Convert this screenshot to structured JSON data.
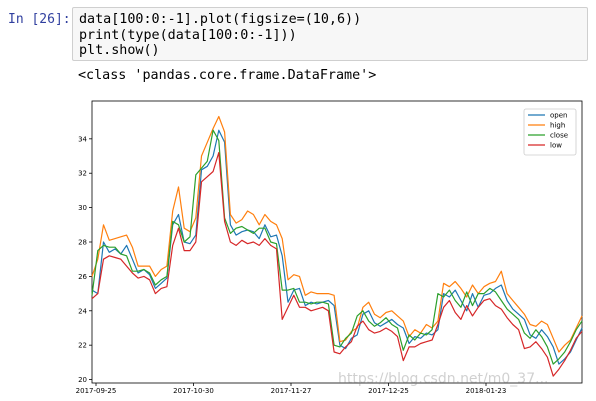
{
  "cell": {
    "prompt": "In [26]:",
    "code_lines": [
      "data[100:0:-1].plot(figsize=(10,6))",
      "print(type(data[100:0:-1]))",
      "plt.show()"
    ],
    "stdout": "<class 'pandas.core.frame.DataFrame'>"
  },
  "watermark": "https://blog.csdn.net/m0_37...",
  "chart_data": {
    "type": "line",
    "title": "",
    "xlabel": "",
    "ylabel": "",
    "ylim": [
      19.8,
      36.2
    ],
    "yticks": [
      20,
      22,
      24,
      26,
      28,
      30,
      32,
      34
    ],
    "xticks": [
      "2017-09-25",
      "2017-10-30",
      "2017-11-27",
      "2017-12-25",
      "2018-01-23"
    ],
    "legend_position": "top-right",
    "series": [
      {
        "name": "open",
        "color": "#1f77b4",
        "values": [
          25.2,
          25.0,
          28.0,
          27.4,
          27.6,
          27.3,
          27.8,
          27.0,
          26.2,
          26.4,
          26.1,
          25.3,
          25.6,
          25.9,
          29.0,
          29.6,
          28.0,
          27.9,
          28.4,
          32.2,
          32.4,
          33.0,
          34.5,
          33.8,
          29.0,
          28.4,
          28.6,
          28.7,
          28.6,
          28.2,
          29.0,
          28.3,
          28.4,
          27.2,
          24.5,
          25.2,
          25.3,
          24.3,
          24.5,
          24.4,
          24.5,
          24.6,
          24.3,
          22.0,
          21.8,
          22.4,
          22.6,
          23.8,
          24.0,
          23.3,
          23.1,
          23.3,
          23.5,
          23.2,
          23.0,
          22.1,
          22.5,
          22.4,
          22.7,
          22.6,
          22.9,
          25.0,
          24.8,
          25.2,
          24.6,
          24.0,
          25.0,
          24.2,
          24.9,
          25.0,
          25.3,
          25.5,
          24.6,
          24.1,
          23.8,
          23.5,
          22.6,
          22.4,
          22.9,
          22.5,
          21.9,
          20.9,
          21.2,
          21.6,
          22.3,
          23.0
        ]
      },
      {
        "name": "high",
        "color": "#ff7f0e",
        "values": [
          26.0,
          27.0,
          29.0,
          28.1,
          28.2,
          28.3,
          28.4,
          27.7,
          26.6,
          26.6,
          26.6,
          26.0,
          26.4,
          26.6,
          29.8,
          31.2,
          28.8,
          28.6,
          29.4,
          33.0,
          33.8,
          34.6,
          35.3,
          34.4,
          29.6,
          29.1,
          29.3,
          29.8,
          29.6,
          29.0,
          29.6,
          29.2,
          29.0,
          28.2,
          25.8,
          26.1,
          26.0,
          24.9,
          25.1,
          25.0,
          25.0,
          25.0,
          24.9,
          22.2,
          22.3,
          22.8,
          23.0,
          24.2,
          24.5,
          23.8,
          23.6,
          23.9,
          24.0,
          23.7,
          23.4,
          22.5,
          22.9,
          22.7,
          23.2,
          23.0,
          23.4,
          25.6,
          25.4,
          25.7,
          25.3,
          24.8,
          25.5,
          25.0,
          25.4,
          25.6,
          25.7,
          26.3,
          25.0,
          24.6,
          24.2,
          23.8,
          23.2,
          23.1,
          23.4,
          23.2,
          22.4,
          21.6,
          22.0,
          22.3,
          23.0,
          23.7
        ]
      },
      {
        "name": "close",
        "color": "#2ca02c",
        "values": [
          24.9,
          27.5,
          27.8,
          27.7,
          27.7,
          27.3,
          27.2,
          26.3,
          26.3,
          26.4,
          26.2,
          25.5,
          25.8,
          26.0,
          29.2,
          29.0,
          28.0,
          28.3,
          31.9,
          32.3,
          32.7,
          34.5,
          33.9,
          29.4,
          28.5,
          28.8,
          28.9,
          28.7,
          28.5,
          28.8,
          28.8,
          28.0,
          27.9,
          25.2,
          25.2,
          25.3,
          24.5,
          24.5,
          24.4,
          24.5,
          24.5,
          24.4,
          22.0,
          21.9,
          22.4,
          22.7,
          23.7,
          24.0,
          23.4,
          23.1,
          23.3,
          23.6,
          23.2,
          23.0,
          21.7,
          22.6,
          22.3,
          22.7,
          22.6,
          22.9,
          25.0,
          24.8,
          25.2,
          24.6,
          24.2,
          25.1,
          24.3,
          25.0,
          25.0,
          25.3,
          25.1,
          24.6,
          24.1,
          23.8,
          23.5,
          22.7,
          22.4,
          22.9,
          22.5,
          21.9,
          20.9,
          21.2,
          21.6,
          22.2,
          22.9,
          23.4
        ]
      },
      {
        "name": "low",
        "color": "#d62728",
        "values": [
          24.7,
          25.0,
          27.0,
          27.2,
          27.1,
          27.0,
          26.6,
          26.2,
          25.9,
          26.0,
          25.8,
          25.0,
          25.3,
          25.4,
          27.8,
          28.8,
          27.5,
          27.5,
          28.0,
          31.5,
          31.8,
          32.1,
          33.2,
          29.2,
          28.0,
          27.8,
          28.1,
          27.9,
          28.0,
          27.8,
          28.2,
          27.8,
          27.6,
          23.5,
          24.2,
          24.9,
          24.2,
          24.2,
          24.0,
          24.1,
          24.2,
          24.0,
          21.6,
          21.5,
          21.9,
          22.2,
          23.1,
          23.4,
          22.9,
          22.7,
          22.8,
          23.0,
          22.8,
          22.5,
          21.1,
          21.9,
          21.9,
          22.1,
          22.2,
          22.3,
          23.2,
          24.2,
          24.6,
          23.9,
          23.5,
          24.3,
          23.7,
          24.2,
          24.6,
          24.7,
          24.3,
          24.1,
          23.6,
          23.2,
          22.9,
          21.8,
          21.9,
          22.2,
          21.8,
          21.3,
          20.2,
          20.6,
          21.1,
          21.7,
          22.4,
          22.8
        ]
      }
    ]
  }
}
